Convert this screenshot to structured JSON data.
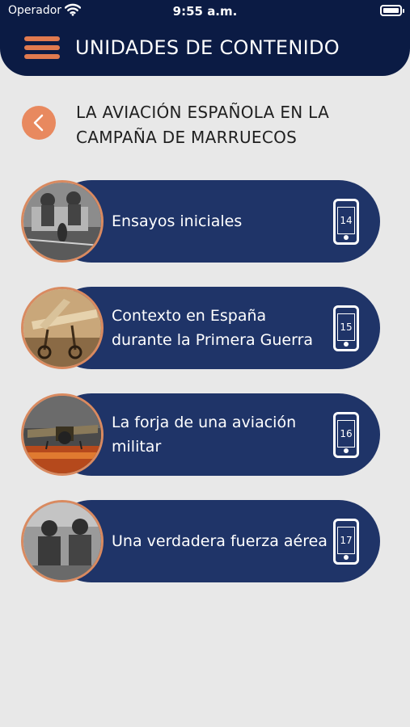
{
  "status_bar": {
    "carrier": "Operador",
    "time": "9:55 a.m."
  },
  "header": {
    "title": "UNIDADES DE CONTENIDO"
  },
  "section": {
    "title_line1": "LA AVIACIÓN ESPAÑOLA EN LA",
    "title_line2": "CAMPAÑA DE MARRUECOS"
  },
  "units": [
    {
      "label": "Ensayos iniciales",
      "number": "14"
    },
    {
      "label": "Contexto en España durante la Primera Guerra",
      "number": "15"
    },
    {
      "label": "La forja de una aviación militar",
      "number": "16"
    },
    {
      "label": "Una verdadera fuerza aérea",
      "number": "17"
    }
  ],
  "colors": {
    "navy": "#0b1b44",
    "card": "#1f3468",
    "accent": "#e07a4f",
    "background": "#e8e8e8"
  },
  "icons": {
    "menu": "hamburger-icon",
    "back": "chevron-left-icon",
    "unit": "phone-icon"
  }
}
